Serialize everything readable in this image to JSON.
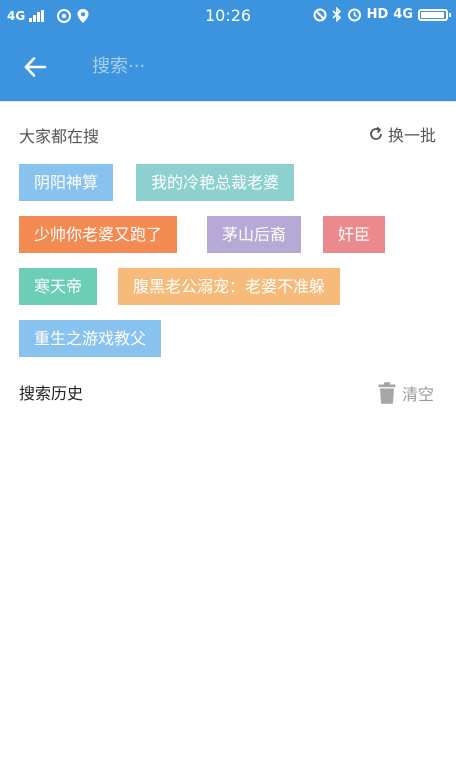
{
  "status_bar": {
    "network_left": "4G",
    "time": "10:26",
    "hd": "HD",
    "network_right": "4G",
    "battery_level": 0.95
  },
  "app_bar": {
    "back_icon": "arrow-left-icon",
    "search_placeholder": "搜索···"
  },
  "hot": {
    "title": "大家都在搜",
    "refresh_label": "换一批",
    "refresh_icon": "refresh-icon",
    "tags": [
      {
        "label": "阴阳神算",
        "color": "#88c2ee"
      },
      {
        "label": "我的冷艳总裁老婆",
        "color": "#8dd1cf"
      },
      {
        "label": "少帅你老婆又跑了",
        "color": "#f38a52"
      },
      {
        "label": "茅山后裔",
        "color": "#b6a9d5"
      },
      {
        "label": "奸臣",
        "color": "#ea8a8c"
      },
      {
        "label": "寒天帝",
        "color": "#6dceb6"
      },
      {
        "label": "腹黑老公溺宠：老婆不准躲",
        "color": "#f6bb7a"
      },
      {
        "label": "重生之游戏教父",
        "color": "#88c2ee"
      }
    ]
  },
  "history": {
    "title": "搜索历史",
    "clear_label": "清空",
    "clear_icon": "trash-icon"
  }
}
